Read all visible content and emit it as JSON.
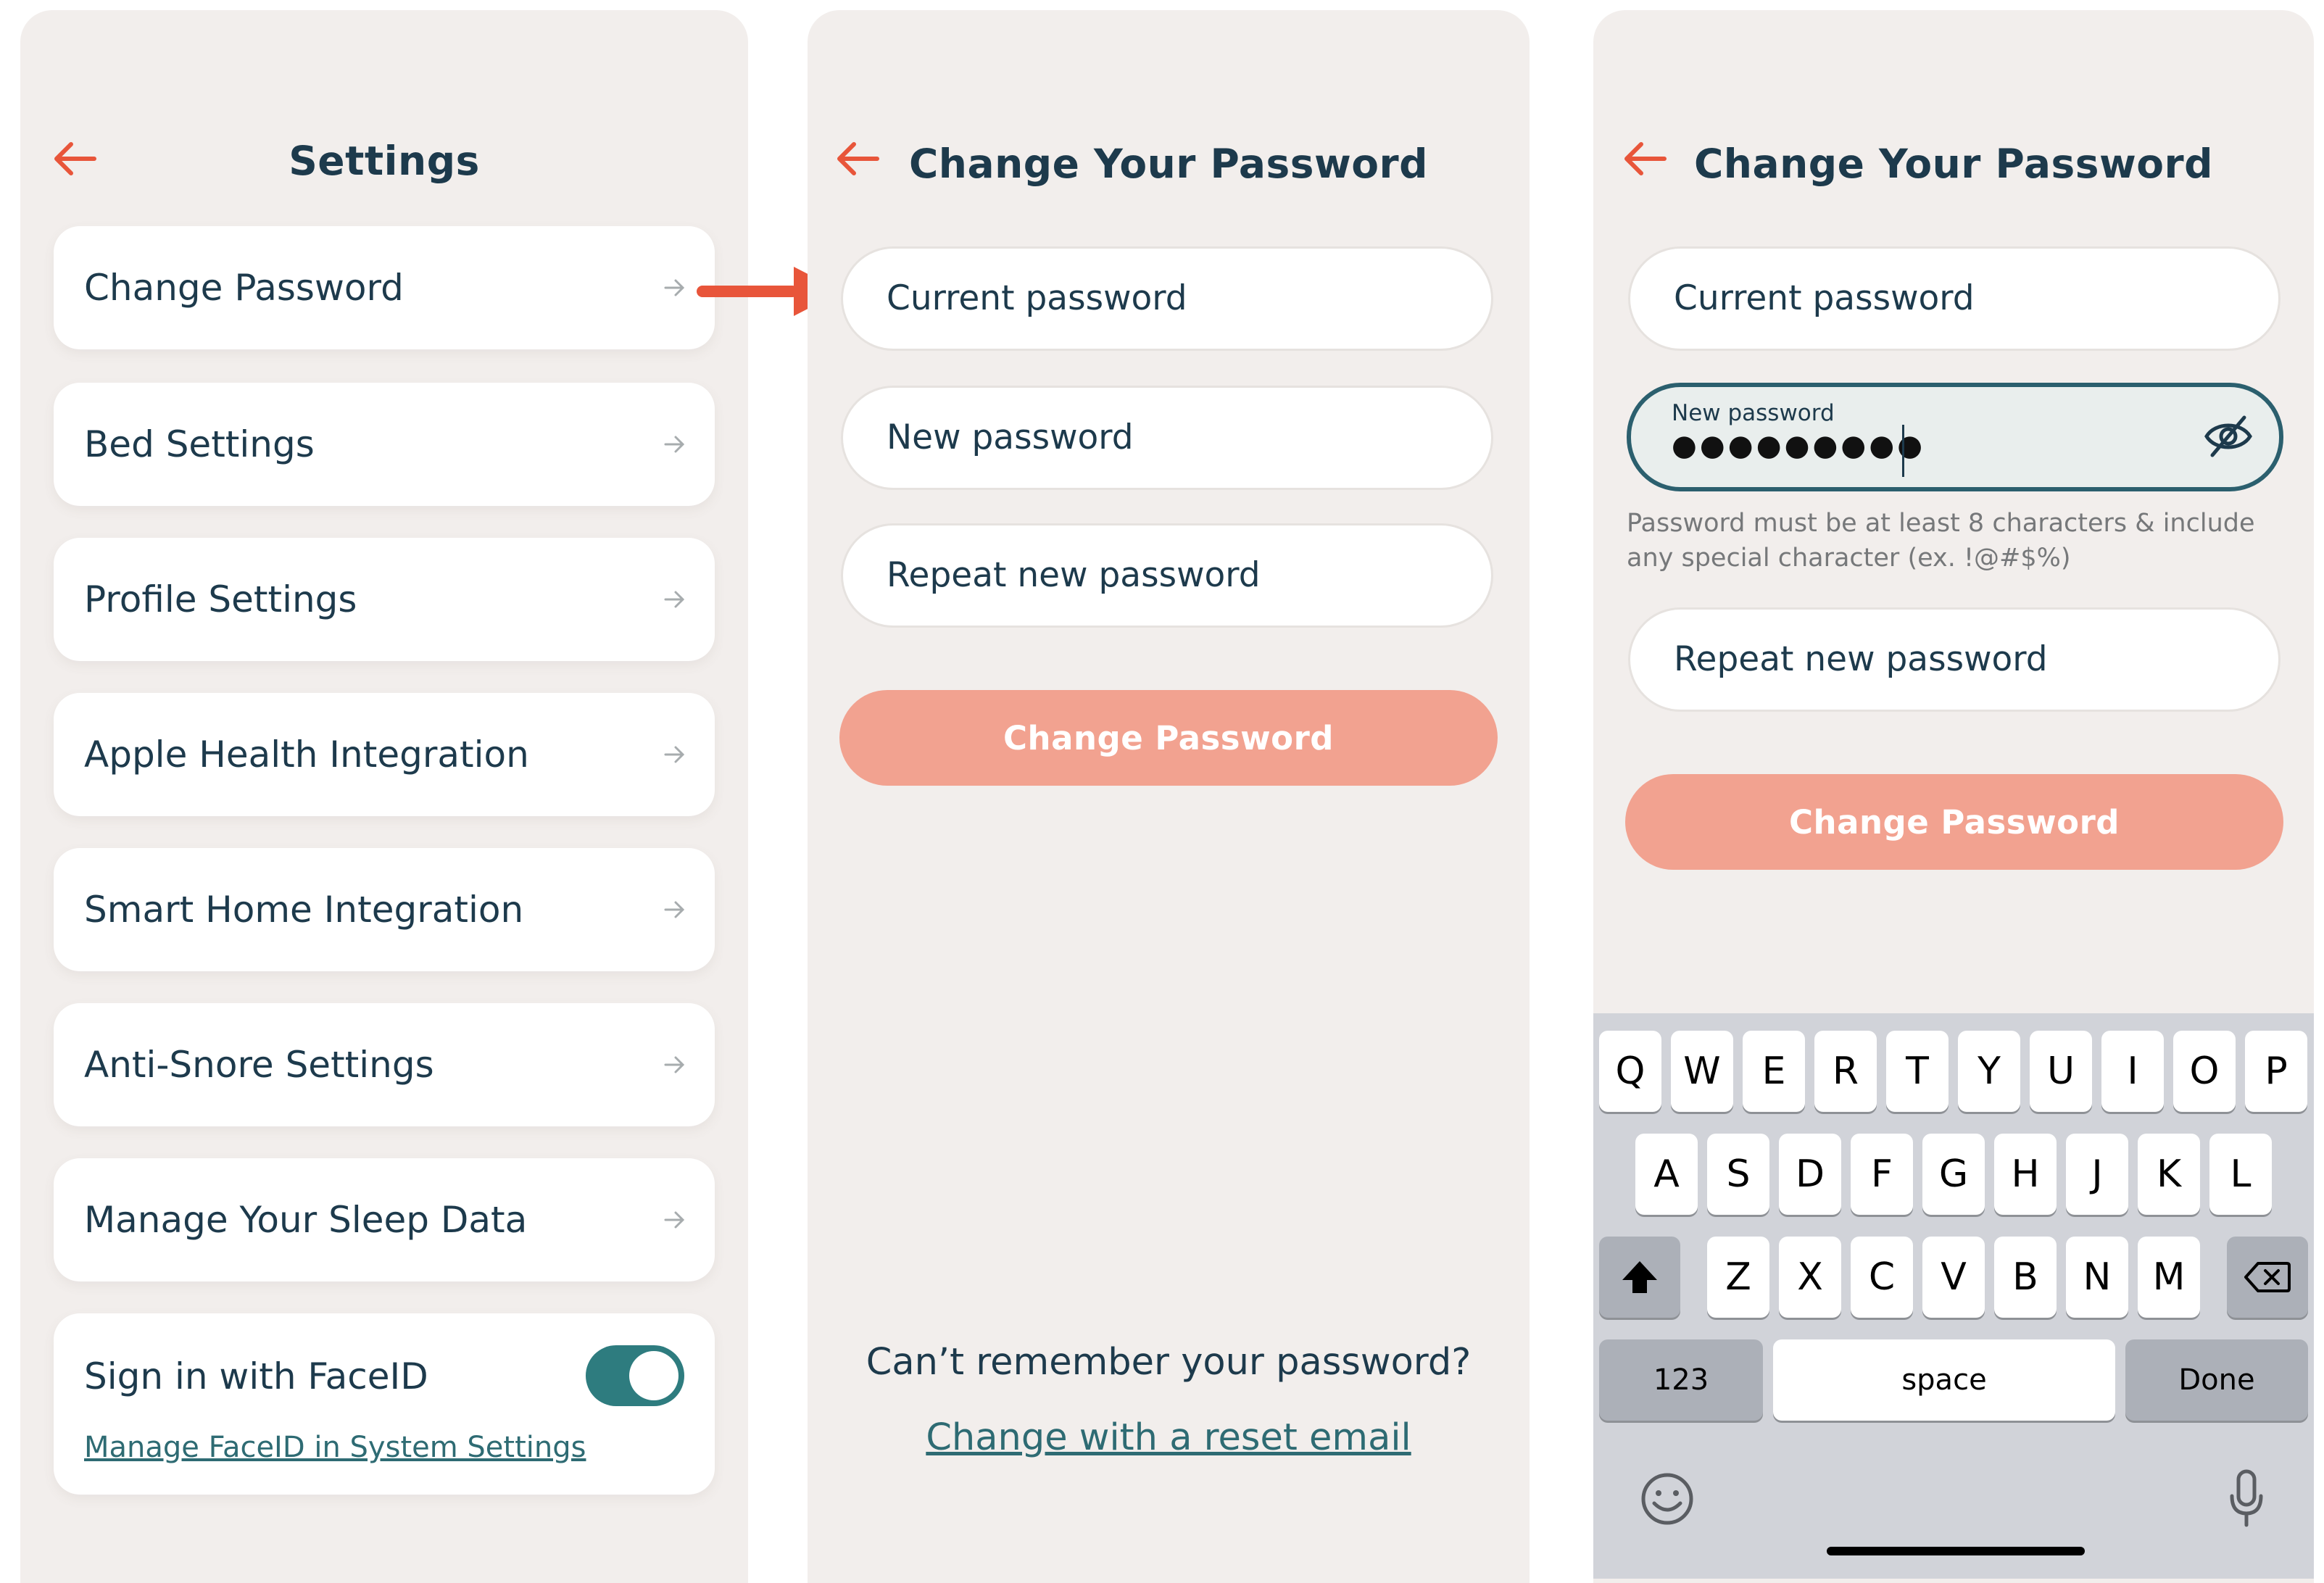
{
  "settings_screen": {
    "title": "Settings",
    "items": [
      {
        "label": "Change Password"
      },
      {
        "label": "Bed Settings"
      },
      {
        "label": "Profile Settings"
      },
      {
        "label": "Apple Health Integration"
      },
      {
        "label": "Smart Home Integration"
      },
      {
        "label": "Anti-Snore Settings"
      },
      {
        "label": "Manage Your Sleep Data"
      }
    ],
    "faceid": {
      "label": "Sign in with FaceID",
      "link": "Manage FaceID in System Settings",
      "enabled": true
    }
  },
  "change_password_screen": {
    "title": "Change Your Password",
    "current_password": "Current password",
    "new_password": "New password",
    "repeat_password": "Repeat new password",
    "button": "Change Password",
    "forgot_question": "Can’t remember your password?",
    "reset_link": "Change with a reset email"
  },
  "change_password_typing_screen": {
    "title": "Change Your Password",
    "current_password": "Current password",
    "new_password_label": "New password",
    "new_password_value": "●●●●●●●●●",
    "hint": "Password must be at least 8 characters & include any special character (ex. !@#$%)",
    "repeat_password": "Repeat new password",
    "button": "Change Password"
  },
  "keyboard": {
    "row1": [
      "Q",
      "W",
      "E",
      "R",
      "T",
      "Y",
      "U",
      "I",
      "O",
      "P"
    ],
    "row2": [
      "A",
      "S",
      "D",
      "F",
      "G",
      "H",
      "J",
      "K",
      "L"
    ],
    "row3": [
      "Z",
      "X",
      "C",
      "V",
      "B",
      "N",
      "M"
    ],
    "numbers_key": "123",
    "space_key": "space",
    "done_key": "Done"
  },
  "colors": {
    "background": "#f2eeec",
    "accent_orange": "#e8553a",
    "button_salmon": "#f2a290",
    "primary_text": "#1d3a4c",
    "toggle_teal": "#2e7c7f"
  }
}
